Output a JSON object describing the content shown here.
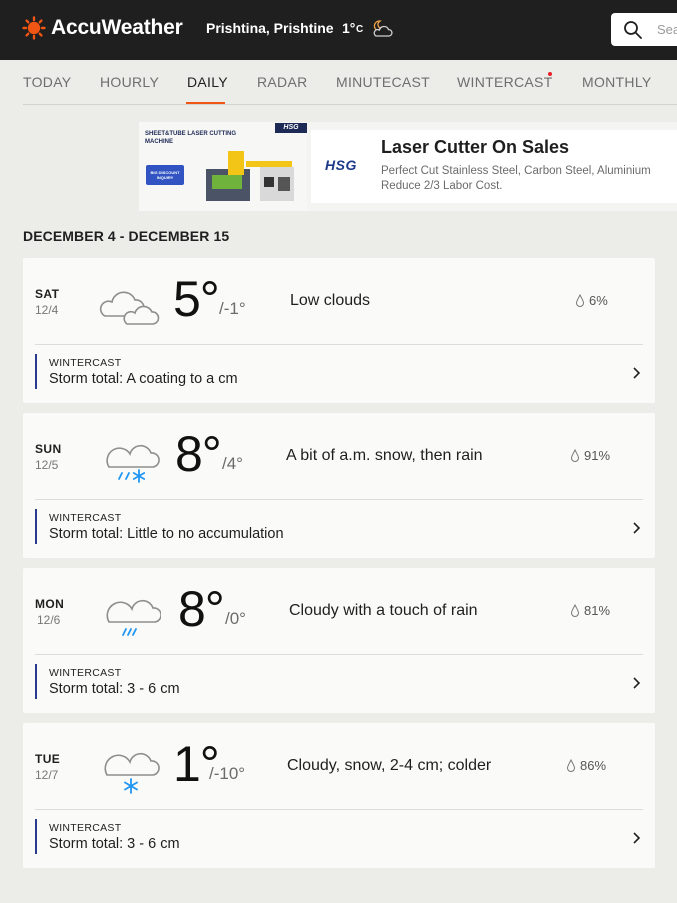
{
  "header": {
    "brand": "AccuWeather",
    "location": "Prishtina, Prishtine",
    "current_temp": "1°",
    "current_unit": "C",
    "current_icon": "partly-cloudy-night-icon",
    "search_placeholder": "Sea"
  },
  "nav": {
    "tabs": [
      {
        "label": "TODAY",
        "active": false
      },
      {
        "label": "HOURLY",
        "active": false
      },
      {
        "label": "DAILY",
        "active": true
      },
      {
        "label": "RADAR",
        "active": false
      },
      {
        "label": "MINUTECAST",
        "active": false
      },
      {
        "label": "WINTERCAST",
        "active": false,
        "notification_dot": true
      },
      {
        "label": "MONTHLY",
        "active": false
      }
    ],
    "accent_color": "#f05514"
  },
  "ad": {
    "image_caption": "SHEET&TUBE LASER CUTTING MACHINE",
    "image_badge": "HSG",
    "image_sale": "BIG DISCOUNT INQUIRY",
    "brand": "HSG",
    "title": "Laser Cutter On Sales",
    "line1": "Perfect Cut Stainless Steel, Carbon Steel, Aluminium",
    "line2": "Reduce 2/3 Labor Cost."
  },
  "range_title": "DECEMBER 4 - DECEMBER 15",
  "days": [
    {
      "day": "SAT",
      "date": "12/4",
      "icon": "cloudy-icon",
      "hi": "5°",
      "lo": "/-1°",
      "phrase": "Low clouds",
      "precip": "6%",
      "wintercast_label": "WINTERCAST",
      "wintercast_total": "Storm total: A coating to a cm"
    },
    {
      "day": "SUN",
      "date": "12/5",
      "icon": "rain-and-snow-icon",
      "hi": "8°",
      "lo": "/4°",
      "phrase": "A bit of a.m. snow, then rain",
      "precip": "91%",
      "wintercast_label": "WINTERCAST",
      "wintercast_total": "Storm total: Little to no accumulation"
    },
    {
      "day": "MON",
      "date": "12/6",
      "icon": "rain-icon",
      "hi": "8°",
      "lo": "/0°",
      "phrase": "Cloudy with a touch of rain",
      "precip": "81%",
      "wintercast_label": "WINTERCAST",
      "wintercast_total": "Storm total: 3 - 6 cm"
    },
    {
      "day": "TUE",
      "date": "12/7",
      "icon": "snow-icon",
      "hi": "1°",
      "lo": "/-10°",
      "phrase": "Cloudy, snow, 2-4 cm; colder",
      "precip": "86%",
      "wintercast_label": "WINTERCAST",
      "wintercast_total": "Storm total: 3 - 6 cm"
    }
  ],
  "colors": {
    "header_bg": "#1f1f1f",
    "wintercast_bar": "#2a3a8e",
    "precip_icon_blue": "#2196f3"
  }
}
